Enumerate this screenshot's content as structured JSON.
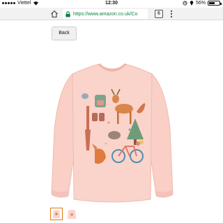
{
  "status_bar": {
    "carrier": "Viettel",
    "time": "12:30",
    "battery_text": "56%",
    "battery_level": 0.56
  },
  "browser": {
    "url": "https://www.amazon.co.uk/Co",
    "tab_count": "6"
  },
  "page": {
    "back_label": "Back"
  },
  "product": {
    "shirt_color": "#f9cfc6",
    "thumbnails": [
      {
        "selected": true
      },
      {
        "selected": false
      }
    ]
  },
  "icons": [
    "home-icon",
    "lock-icon",
    "menu-icon",
    "wifi-icon",
    "alarm-icon",
    "location-icon"
  ]
}
